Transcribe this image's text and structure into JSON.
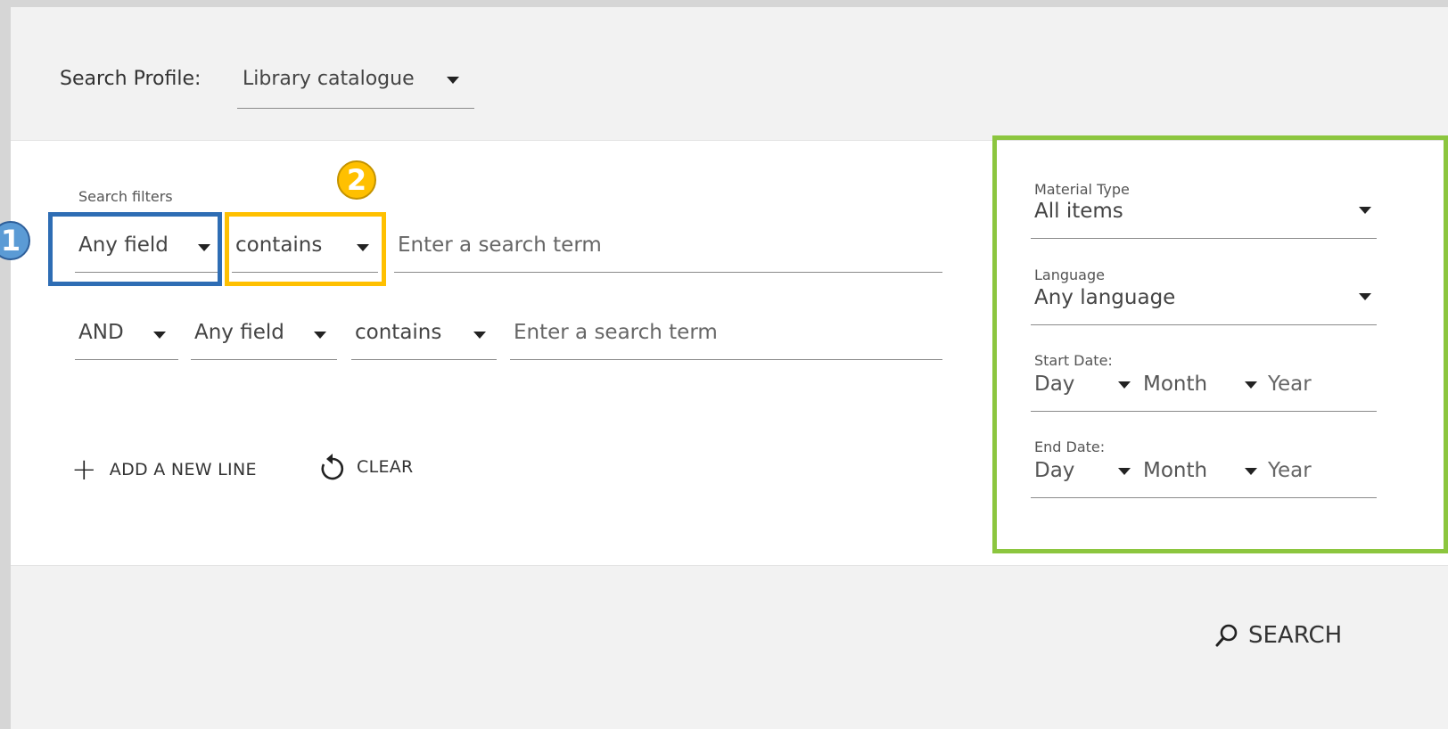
{
  "search_profile": {
    "label": "Search Profile:",
    "selected": "Library catalogue"
  },
  "filters": {
    "caption": "Search filters",
    "line1": {
      "field": "Any field",
      "operator": "contains",
      "placeholder": "Enter a search term"
    },
    "line2": {
      "boolean": "AND",
      "field": "Any field",
      "operator": "contains",
      "placeholder": "Enter a search term"
    },
    "add_line_label": "ADD A NEW LINE",
    "clear_label": "CLEAR"
  },
  "sidebar": {
    "material_type": {
      "label": "Material Type",
      "selected": "All items"
    },
    "language": {
      "label": "Language",
      "selected": "Any language"
    },
    "start_date": {
      "label": "Start Date:",
      "day": "Day",
      "month": "Month",
      "year": "Year"
    },
    "end_date": {
      "label": "End Date:",
      "day": "Day",
      "month": "Month",
      "year": "Year"
    }
  },
  "search_button_label": "SEARCH",
  "annotations": {
    "badge1": "1",
    "badge2": "2"
  },
  "colors": {
    "highlight_blue": "#2e6db4",
    "highlight_gold": "#ffc000",
    "highlight_green": "#8cc63f",
    "badge_blue": "#5b9bd5"
  },
  "icons": {
    "dropdown": "caret-down-icon",
    "add": "plus-icon",
    "clear": "reset-icon",
    "search": "magnifier-icon"
  }
}
